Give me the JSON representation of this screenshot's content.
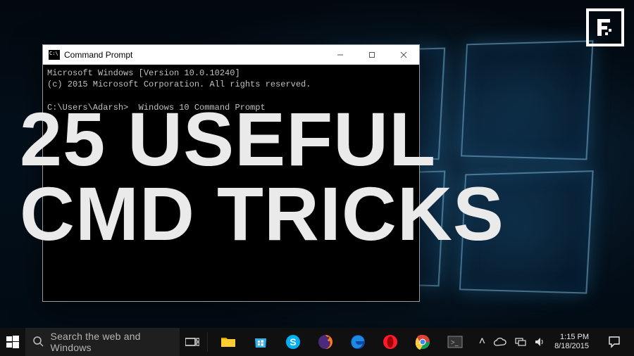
{
  "headline": {
    "line1": "25 USEFUL",
    "line2": "CMD TRICKS"
  },
  "watermark": {
    "alt": "F"
  },
  "cmd": {
    "title": "Command Prompt",
    "line1": "Microsoft Windows [Version 10.0.10240]",
    "line2": "(c) 2015 Microsoft Corporation. All rights reserved.",
    "prompt": "C:\\Users\\Adarsh>  Windows 10 Command Prompt"
  },
  "taskbar": {
    "search_placeholder": "Search the web and Windows",
    "apps": [
      {
        "name": "file-explorer",
        "color": "#ffcc33"
      },
      {
        "name": "windows-store",
        "color": "#35b1ec"
      },
      {
        "name": "skype",
        "color": "#00aff0"
      },
      {
        "name": "firefox",
        "color": "#ff7b1a"
      },
      {
        "name": "edge",
        "color": "#1e88e5"
      },
      {
        "name": "opera",
        "color": "#ff1b2d"
      },
      {
        "name": "chrome",
        "color": "#ffffff"
      },
      {
        "name": "terminal",
        "color": "#555555"
      }
    ],
    "tray": {
      "show_hidden": "˄",
      "time": "1:15 PM",
      "date": "8/18/2015"
    }
  }
}
